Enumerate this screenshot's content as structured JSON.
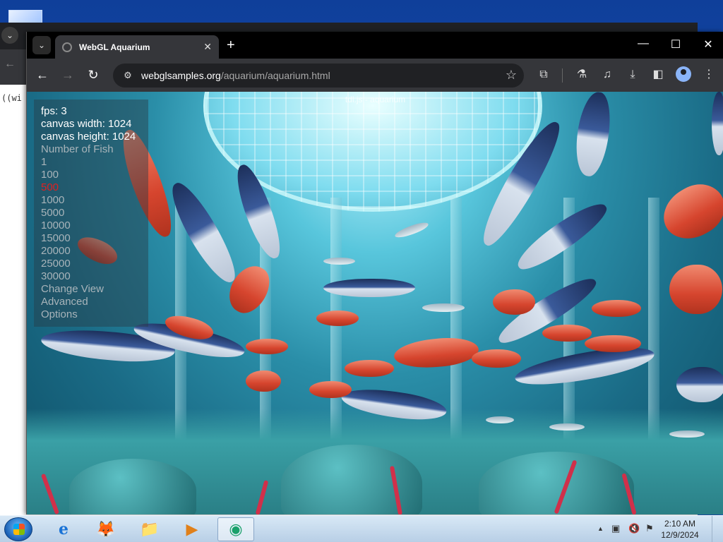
{
  "background_window": {
    "tab_menu": "⌄",
    "back": "←",
    "code_text": "((wi"
  },
  "browser": {
    "tab_search": "⌄",
    "tab_title": "WebGL Aquarium",
    "tab_close": "✕",
    "new_tab": "+",
    "minimize": "—",
    "maximize": "☐",
    "close": "✕",
    "back": "←",
    "forward": "→",
    "reload": "↻",
    "site_info": "⚙",
    "url_host": "webglsamples.org",
    "url_path": "/aquarium/aquarium.html",
    "star": "☆",
    "extensions": "⧉",
    "labs": "⚗",
    "media": "♫",
    "download": "⤓",
    "sidebar": "◧",
    "menu": "⋮"
  },
  "aquarium": {
    "title": "tdl.js - aquarium",
    "fps_label": "fps: 3",
    "canvas_width": "canvas width: 1024",
    "canvas_height": "canvas height: 1024",
    "number_of_fish_label": "Number of Fish",
    "fish_options": [
      "1",
      "100",
      "500",
      "1000",
      "5000",
      "10000",
      "15000",
      "20000",
      "25000",
      "30000"
    ],
    "selected_fish": "500",
    "change_view": "Change View",
    "advanced": "Advanced",
    "options": "Options"
  },
  "taskbar": {
    "apps": [
      {
        "name": "internet-explorer",
        "glyph": "e"
      },
      {
        "name": "firefox",
        "glyph": "🦊"
      },
      {
        "name": "file-explorer",
        "glyph": "📁"
      },
      {
        "name": "media-player",
        "glyph": "▶"
      },
      {
        "name": "chrome",
        "glyph": "◉"
      }
    ],
    "tray": {
      "show_hidden": "▲",
      "network": "▣",
      "volume": "🔇",
      "flag": "⚑"
    },
    "time": "2:10 AM",
    "date": "12/9/2024"
  },
  "colors": {
    "selected_option": "#e02020",
    "chrome_dark": "#202124",
    "chrome_toolbar": "#35363a"
  }
}
